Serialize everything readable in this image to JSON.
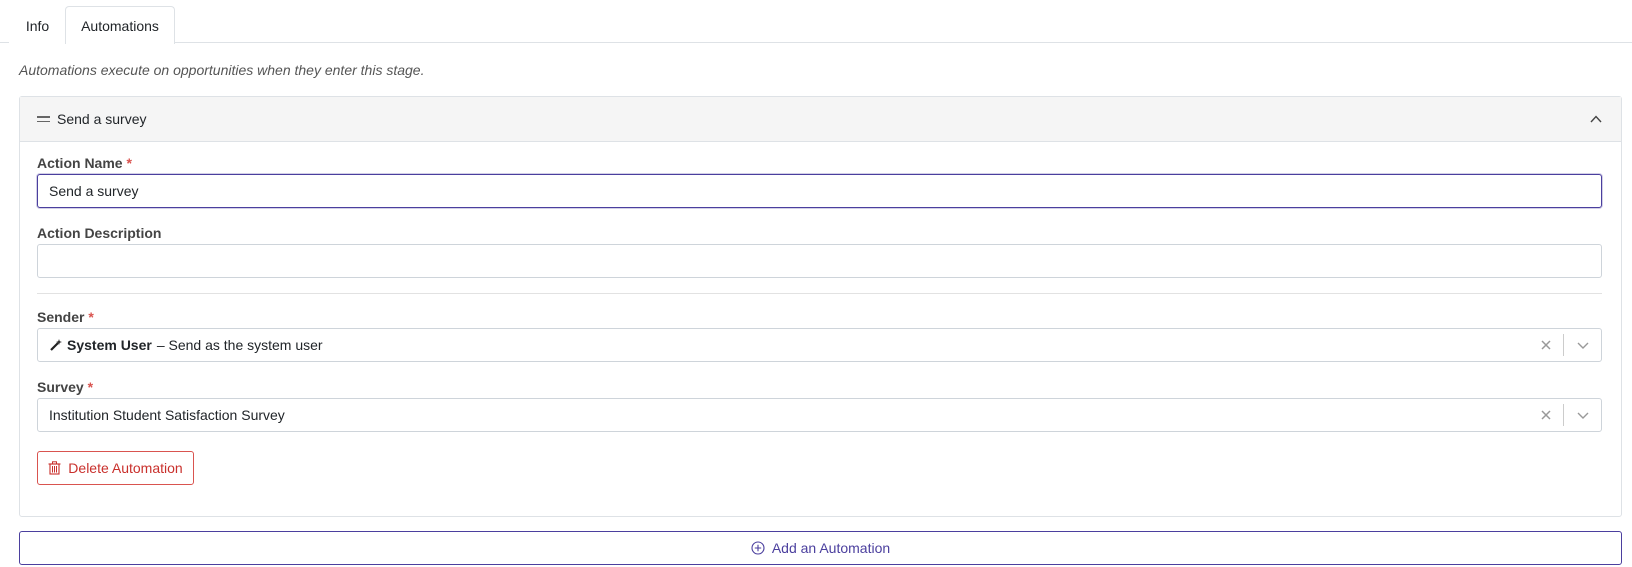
{
  "tabs": [
    {
      "label": "Info",
      "active": false
    },
    {
      "label": "Automations",
      "active": true
    }
  ],
  "hint": "Automations execute on opportunities when they enter this stage.",
  "automation": {
    "title": "Send a survey",
    "action_name_label": "Action Name",
    "action_name_value": "Send a survey",
    "action_description_label": "Action Description",
    "action_description_value": "",
    "sender_label": "Sender",
    "sender_name": "System User",
    "sender_detail": "– Send as the system user",
    "survey_label": "Survey",
    "survey_value": "Institution Student Satisfaction Survey",
    "required_mark": "*",
    "delete_label": "Delete Automation"
  },
  "add_label": "Add an Automation",
  "colors": {
    "accent": "#4b3f9e",
    "danger": "#d9534f",
    "header_bg": "#f5f5f5"
  },
  "icons": [
    "drag-handle-icon",
    "chevron-up-icon",
    "magic-wand-icon",
    "clear-x-icon",
    "chevron-down-icon",
    "trash-icon",
    "plus-circle-icon"
  ]
}
